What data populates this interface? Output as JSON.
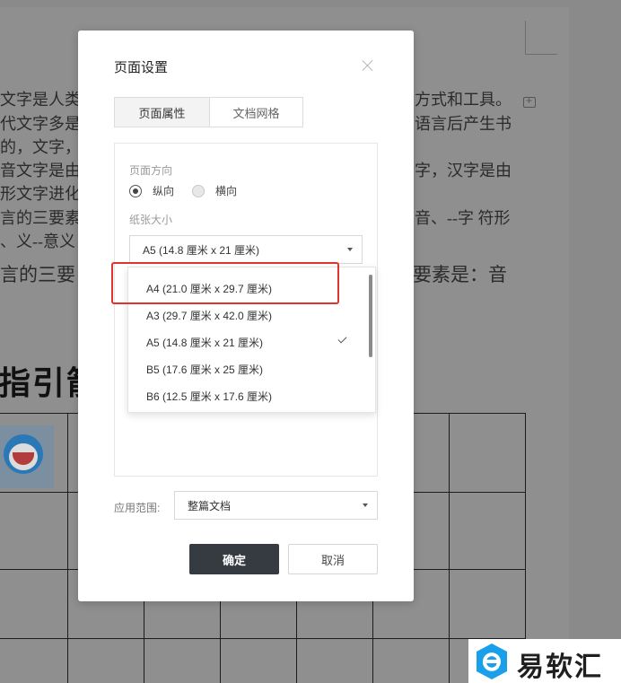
{
  "document": {
    "lines": [
      {
        "left": "文字是人类",
        "right": "方式和工具。"
      },
      {
        "left": "代文字多是",
        "right": "语言后产生书"
      },
      {
        "left": "的，文字，",
        "right": ""
      },
      {
        "left": "音文字是由",
        "right": "字，汉字是由"
      },
      {
        "left": "形文字进化",
        "right": ""
      },
      {
        "left": "言的三要素",
        "right": "音、--字  符形"
      },
      {
        "left": "、义--意义",
        "right": ""
      },
      {
        "left": "言的三要",
        "right": "要素是：音"
      }
    ],
    "heading_fragment": "指引箭"
  },
  "dialog": {
    "title": "页面设置",
    "tabs": [
      {
        "label": "页面属性",
        "active": true
      },
      {
        "label": "文档网格",
        "active": false
      }
    ],
    "orientation": {
      "label": "页面方向",
      "options": [
        {
          "label": "纵向",
          "checked": true
        },
        {
          "label": "横向",
          "checked": false
        }
      ]
    },
    "paper_size": {
      "label": "纸张大小",
      "selected": "A5 (14.8 厘米 x 21 厘米)",
      "options": [
        {
          "label": "A4 (21.0 厘米 x 29.7 厘米)",
          "checked": false
        },
        {
          "label": "A3 (29.7 厘米 x 42.0 厘米)",
          "checked": false
        },
        {
          "label": "A5 (14.8 厘米 x 21 厘米)",
          "checked": true
        },
        {
          "label": "B5 (17.6 厘米 x 25 厘米)",
          "checked": false
        },
        {
          "label": "B6 (12.5 厘米 x 17.6 厘米)",
          "checked": false
        }
      ]
    },
    "apply_scope": {
      "label": "应用范围:",
      "value": "整篇文档"
    },
    "ok_label": "确定",
    "cancel_label": "取消"
  },
  "watermark": {
    "text": "易软汇"
  },
  "colors": {
    "highlight": "#e0342f",
    "ok_button": "#363b42",
    "watermark_blue": "#1aa0e8"
  }
}
